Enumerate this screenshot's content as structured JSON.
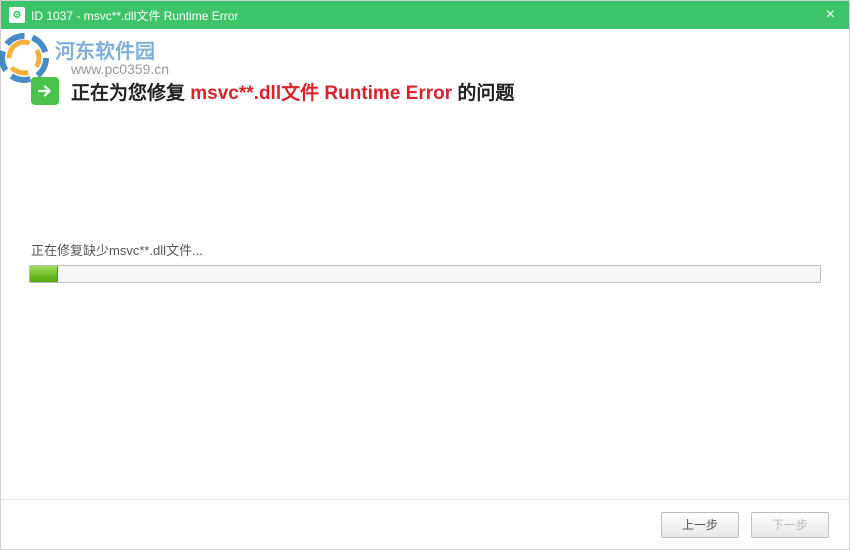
{
  "titlebar": {
    "title": "ID 1037 - msvc**.dll文件 Runtime Error"
  },
  "watermark": {
    "site_name": "河东软件园",
    "url": "www.pc0359.cn"
  },
  "heading": {
    "prefix": "正在为您修复 ",
    "highlight": "msvc**.dll文件 Runtime Error",
    "suffix": " 的问题"
  },
  "status": {
    "text": "正在修复缺少msvc**.dll文件..."
  },
  "footer": {
    "prev_label": "上一步",
    "next_label": "下一步"
  }
}
